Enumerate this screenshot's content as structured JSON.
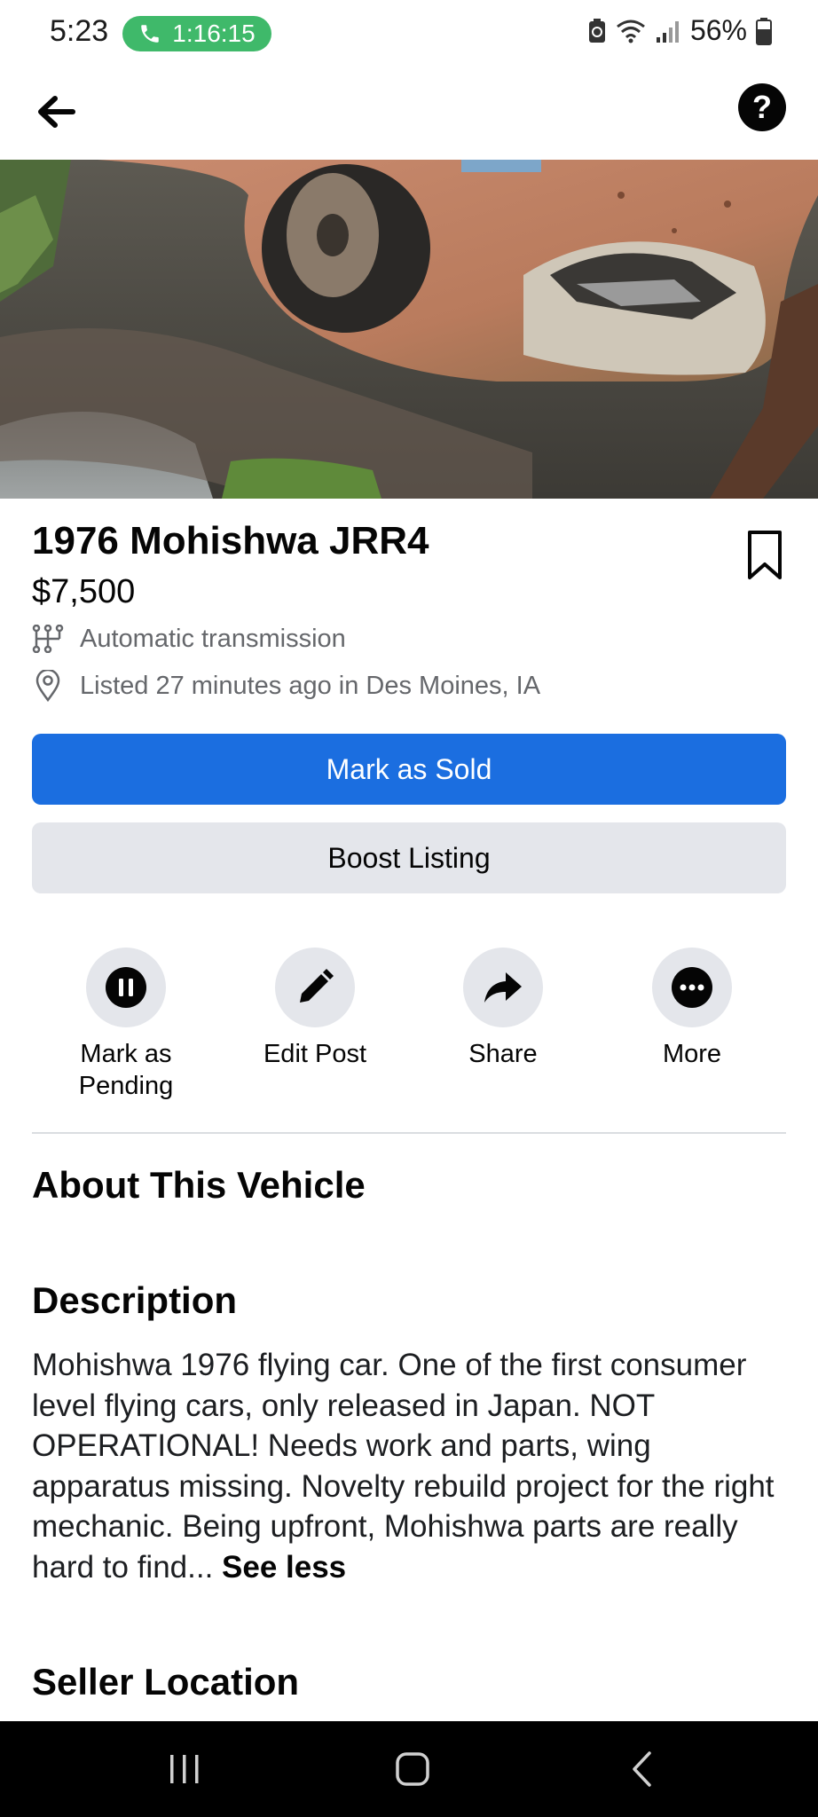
{
  "status_bar": {
    "time": "5:23",
    "call_timer": "1:16:15",
    "battery": "56%"
  },
  "app_bar": {
    "back_icon": "arrow-left-icon",
    "help_label": "?"
  },
  "listing": {
    "title": "1976 Mohishwa JRR4",
    "price": "$7,500",
    "transmission": "Automatic transmission",
    "listed": "Listed 27 minutes ago in Des Moines, IA"
  },
  "buttons": {
    "mark_sold": "Mark as Sold",
    "boost": "Boost Listing"
  },
  "actions": [
    {
      "label": "Mark as\nPending",
      "icon": "pause-icon"
    },
    {
      "label": "Edit Post",
      "icon": "pencil-icon"
    },
    {
      "label": "Share",
      "icon": "share-arrow-icon"
    },
    {
      "label": "More",
      "icon": "more-dots-icon"
    }
  ],
  "sections": {
    "about": "About This Vehicle",
    "description_heading": "Description",
    "description": "Mohishwa 1976 flying car. One of the first consumer level flying cars, only released in Japan. NOT OPERATIONAL! Needs work and parts, wing apparatus missing. Novelty rebuild project for the right mechanic. Being upfront, Mohishwa parts are really hard to find...",
    "see_less": "See less",
    "seller_location": "Seller Location"
  },
  "colors": {
    "primary": "#1b6ee0",
    "secondary_bg": "#e4e6eb",
    "call_pill": "#3fb96a"
  }
}
